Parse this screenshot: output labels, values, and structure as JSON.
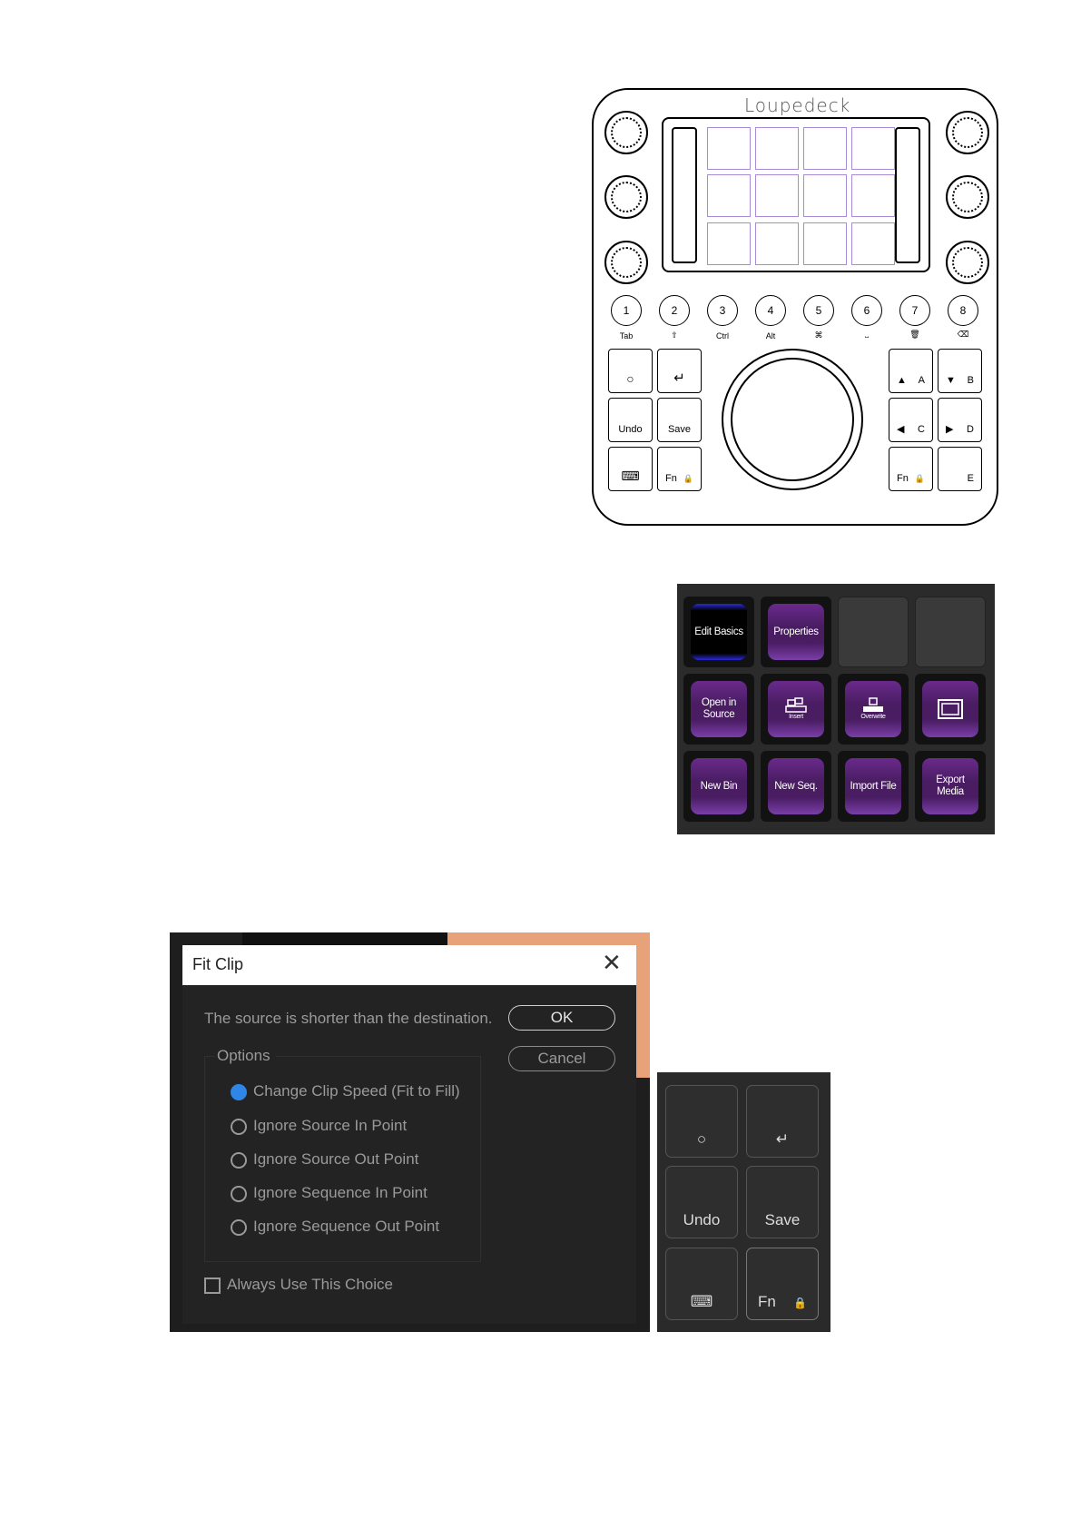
{
  "device": {
    "brand": "Loupedeck",
    "number_buttons": [
      {
        "num": "1",
        "sub": "Tab"
      },
      {
        "num": "2",
        "sub": "⇧"
      },
      {
        "num": "3",
        "sub": "Ctrl"
      },
      {
        "num": "4",
        "sub": "Alt"
      },
      {
        "num": "5",
        "sub": "⌘"
      },
      {
        "num": "6",
        "sub": "⎵"
      },
      {
        "num": "7",
        "sub": "🗑"
      },
      {
        "num": "8",
        "sub": "⌫"
      }
    ],
    "left_buttons": {
      "circle": "○",
      "enter": "↵",
      "undo": "Undo",
      "save": "Save",
      "keyboard": "⌨",
      "fn": "Fn",
      "lock": "🔒"
    },
    "right_buttons": {
      "a_arrow": "▲",
      "a": "A",
      "b_arrow": "▼",
      "b": "B",
      "c_arrow": "◀",
      "c": "C",
      "d_arrow": "▶",
      "d": "D",
      "fn": "Fn",
      "lock": "🔒",
      "e": "E"
    }
  },
  "touch_grid": {
    "row1": [
      "Edit Basics",
      "Properties"
    ],
    "row2": {
      "open_in_source": "Open in Source",
      "insert": "Insert",
      "overwrite": "Overwrite"
    },
    "row3": [
      "New Bin",
      "New Seq.",
      "Import File",
      "Export Media"
    ]
  },
  "dialog": {
    "title": "Fit Clip",
    "close": "✕",
    "message": "The source is shorter than the destination.",
    "ok": "OK",
    "cancel": "Cancel",
    "options_label": "Options",
    "options": [
      "Change Clip Speed (Fit to Fill)",
      "Ignore Source In Point",
      "Ignore Source Out Point",
      "Ignore Sequence In Point",
      "Ignore Sequence Out Point"
    ],
    "selected_option": "Change Clip Speed (Fit to Fill)",
    "always_use": "Always Use This Choice",
    "always_use_checked": false
  },
  "mini_buttons": {
    "circle": "○",
    "enter": "↵",
    "undo": "Undo",
    "save": "Save",
    "keyboard": "⌨",
    "fn": "Fn",
    "lock": "🔒"
  }
}
